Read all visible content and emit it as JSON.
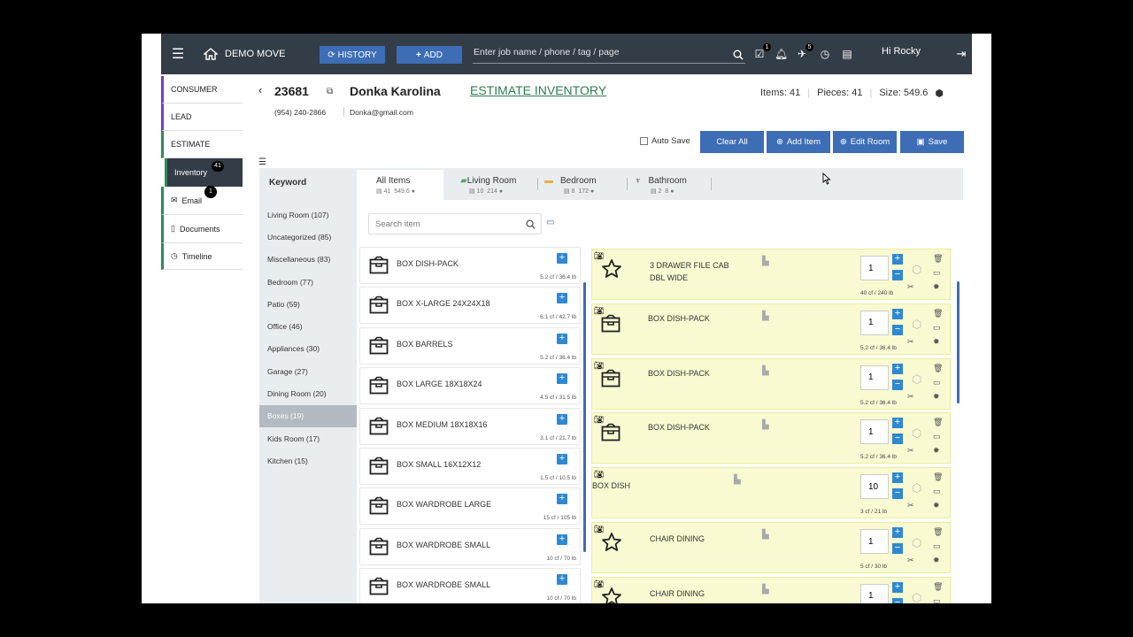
{
  "topbar": {
    "brand": "DEMO MOVE",
    "history_label": "HISTORY",
    "add_label": "ADD",
    "search_placeholder": "Enter job name / phone / tag / page",
    "tasks_badge": "1",
    "pin_badge": "5",
    "user": "Hi Rocky"
  },
  "sidebar": {
    "items": [
      {
        "label": "CONSUMER",
        "color": "#7a3dc0"
      },
      {
        "label": "LEAD",
        "color": "#7a3dc0"
      },
      {
        "label": "ESTIMATE",
        "color": "#2e8b57"
      },
      {
        "label": "Inventory",
        "badge": "41"
      },
      {
        "label": "Email",
        "badge": "1"
      },
      {
        "label": "Documents"
      },
      {
        "label": "Timeline"
      }
    ]
  },
  "job": {
    "number": "23681",
    "customer": "Donka Karolina",
    "section": "ESTIMATE INVENTORY",
    "phone": "(954) 240-2866",
    "email": "Donka@gmail.com",
    "items_label": "Items: 41",
    "pieces_label": "Pieces: 41",
    "size_label": "Size: 549.6"
  },
  "actions": {
    "auto_save": "Auto Save",
    "clear_all": "Clear All",
    "add_item": "Add Item",
    "edit_room": "Edit Room",
    "save": "Save"
  },
  "keyword": {
    "title": "Keyword",
    "categories": [
      "Living Room (107)",
      "Uncategorized (85)",
      "Miscellaneous (83)",
      "Bedroom (77)",
      "Patio (59)",
      "Office (46)",
      "Appliances (30)",
      "Garage (27)",
      "Dining Room (20)",
      "Boxes (19)",
      "Kids Room (17)",
      "Kitchen (15)"
    ],
    "active": "Boxes (19)"
  },
  "tabs": [
    {
      "label": "All Items",
      "count": "41",
      "size": "549.6"
    },
    {
      "label": "Living Room",
      "count": "10",
      "size": "214"
    },
    {
      "label": "Bedroom",
      "count": "8",
      "size": "172"
    },
    {
      "label": "Bathroom",
      "count": "2",
      "size": "8"
    }
  ],
  "search": {
    "placeholder": "Search item"
  },
  "catalog": [
    {
      "name": "BOX DISH-PACK",
      "spec": "5.2 cf / 36.4 lb"
    },
    {
      "name": "BOX X-LARGE 24X24X18",
      "spec": "6.1 cf / 42.7 lb"
    },
    {
      "name": "BOX BARRELS",
      "spec": "5.2 cf / 36.4 lb"
    },
    {
      "name": "BOX LARGE 18X18X24",
      "spec": "4.5 cf / 31.5 lb"
    },
    {
      "name": "BOX MEDIUM 18X18X16",
      "spec": "3.1 cf / 21.7 lb"
    },
    {
      "name": "BOX SMALL 16X12X12",
      "spec": "1.5 cf / 10.5 lb"
    },
    {
      "name": "BOX WARDROBE LARGE",
      "spec": "15 cf / 105 lb"
    },
    {
      "name": "BOX WARDROBE SMALL",
      "spec": "10 cf / 70 lb"
    },
    {
      "name": "BOX WARDROBE SMALL",
      "spec": "10 cf / 70 lb"
    }
  ],
  "selected": [
    {
      "name": "3 DRAWER FILE CAB DBL WIDE",
      "qty": "1",
      "spec": "40 cf / 240 lb",
      "icon": "star"
    },
    {
      "name": "BOX DISH-PACK",
      "qty": "1",
      "spec": "5.2 cf / 36.4 lb",
      "icon": "box"
    },
    {
      "name": "BOX DISH-PACK",
      "qty": "1",
      "spec": "5.2 cf / 36.4 lb",
      "icon": "box"
    },
    {
      "name": "BOX DISH-PACK",
      "qty": "1",
      "spec": "5.2 cf / 36.4 lb",
      "icon": "box"
    },
    {
      "name": "BOX DISH",
      "qty": "10",
      "spec": "3 cf / 21 lb",
      "icon": "none"
    },
    {
      "name": "CHAIR DINING",
      "qty": "1",
      "spec": "5 cf / 30 lb",
      "icon": "star"
    },
    {
      "name": "CHAIR DINING",
      "qty": "1",
      "spec": "",
      "icon": "star"
    }
  ]
}
